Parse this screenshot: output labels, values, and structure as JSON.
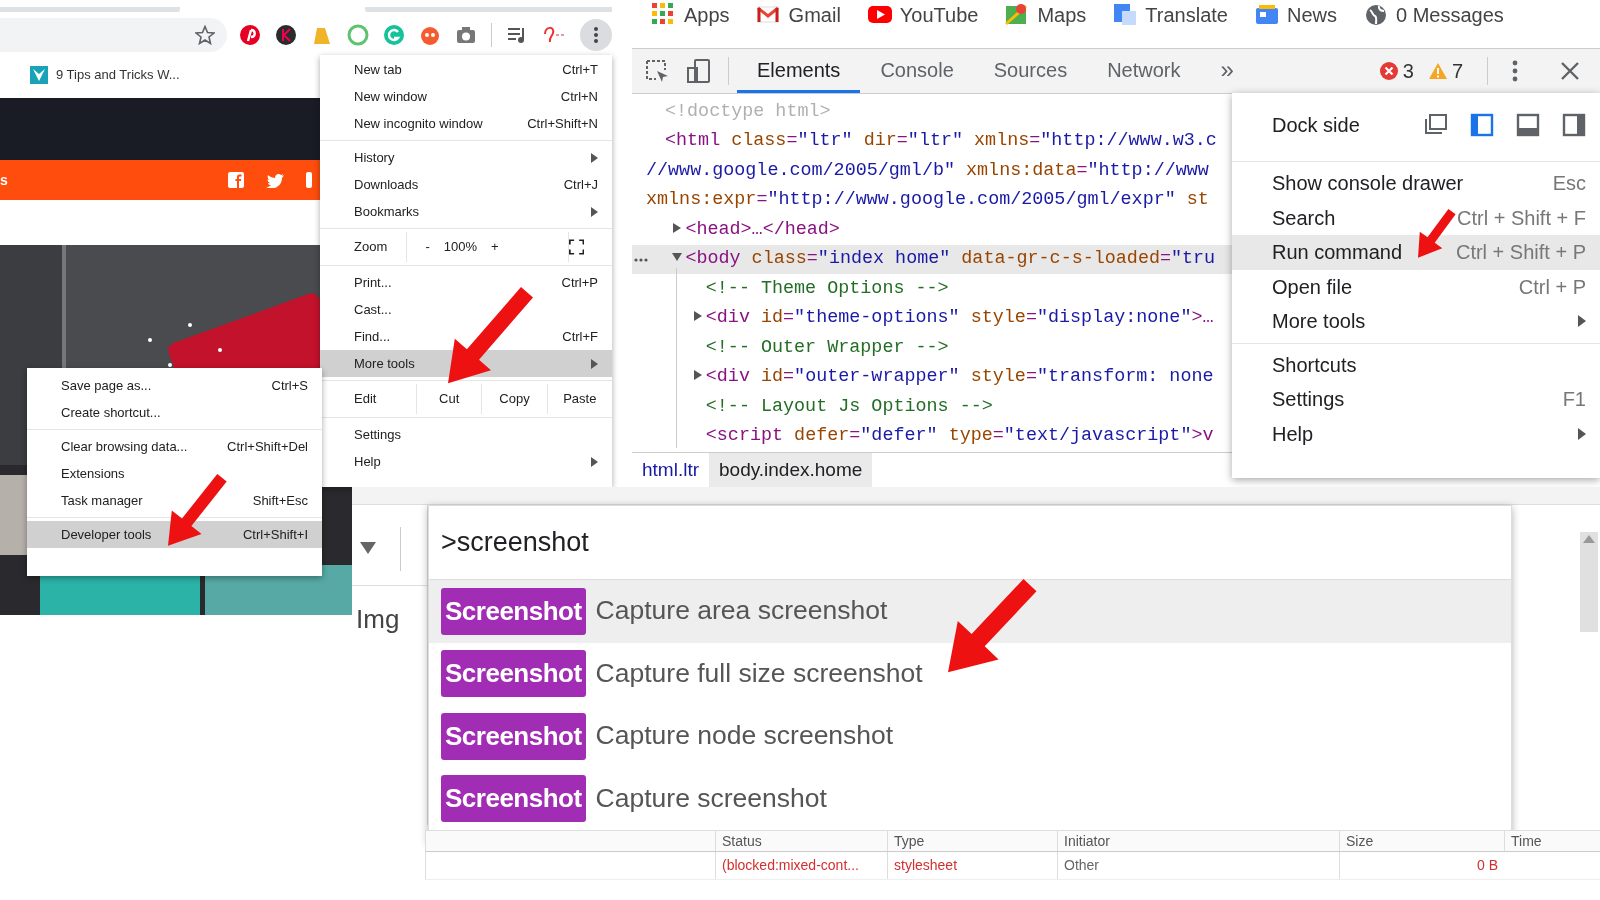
{
  "browser": {
    "bookmark": "9 Tips and Tricks W...",
    "banner_text": "s"
  },
  "chrome_menu": {
    "groups": [
      [
        {
          "kind": "item",
          "label": "New tab",
          "shortcut": "Ctrl+T",
          "submenu": false,
          "selected": false
        },
        {
          "kind": "item",
          "label": "New window",
          "shortcut": "Ctrl+N",
          "submenu": false,
          "selected": false
        },
        {
          "kind": "item",
          "label": "New incognito window",
          "shortcut": "Ctrl+Shift+N",
          "submenu": false,
          "selected": false
        }
      ],
      [
        {
          "kind": "item",
          "label": "History",
          "submenu": true,
          "selected": false
        },
        {
          "kind": "item",
          "label": "Downloads",
          "shortcut": "Ctrl+J",
          "submenu": false,
          "selected": false
        },
        {
          "kind": "item",
          "label": "Bookmarks",
          "submenu": true,
          "selected": false
        }
      ],
      [
        {
          "kind": "zoom",
          "label": "Zoom",
          "minus": "-",
          "value": "100%",
          "plus": "+",
          "submenu": false,
          "selected": false
        }
      ],
      [
        {
          "kind": "item",
          "label": "Print...",
          "shortcut": "Ctrl+P",
          "submenu": false,
          "selected": false
        },
        {
          "kind": "item",
          "label": "Cast...",
          "submenu": false,
          "selected": false
        },
        {
          "kind": "item",
          "label": "Find...",
          "shortcut": "Ctrl+F",
          "submenu": false,
          "selected": false
        },
        {
          "kind": "item",
          "label": "More tools",
          "submenu": true,
          "selected": true
        }
      ],
      [
        {
          "kind": "edit",
          "label": "Edit",
          "actions": [
            "Cut",
            "Copy",
            "Paste"
          ],
          "submenu": false,
          "selected": false
        }
      ],
      [
        {
          "kind": "item",
          "label": "Settings",
          "submenu": false,
          "selected": false
        },
        {
          "kind": "item",
          "label": "Help",
          "submenu": true,
          "selected": false
        }
      ]
    ]
  },
  "more_tools_menu": {
    "groups": [
      [
        {
          "label": "Save page as...",
          "shortcut": "Ctrl+S",
          "selected": false
        },
        {
          "label": "Create shortcut...",
          "selected": false
        }
      ],
      [
        {
          "label": "Clear browsing data...",
          "shortcut": "Ctrl+Shift+Del",
          "selected": false
        },
        {
          "label": "Extensions",
          "selected": false
        },
        {
          "label": "Task manager",
          "shortcut": "Shift+Esc",
          "selected": false
        }
      ],
      [
        {
          "label": "Developer tools",
          "shortcut": "Ctrl+Shift+I",
          "selected": true
        }
      ]
    ]
  },
  "bookmarks_bar": [
    {
      "kind": "apps",
      "label": "Apps"
    },
    {
      "kind": "mail",
      "label": "Gmail"
    },
    {
      "kind": "video",
      "label": "YouTube"
    },
    {
      "kind": "map",
      "label": "Maps"
    },
    {
      "kind": "translate",
      "label": "Translate"
    },
    {
      "kind": "news",
      "label": "News"
    },
    {
      "kind": "globe",
      "label": "0 Messages"
    }
  ],
  "devtools": {
    "tabs": [
      {
        "label": "Elements",
        "selected": true
      },
      {
        "label": "Console",
        "selected": false
      },
      {
        "label": "Sources",
        "selected": false
      },
      {
        "label": "Network",
        "selected": false
      }
    ],
    "overflow": "»",
    "errors": "3",
    "warnings": "7",
    "dom_tree": [
      {
        "selected": false,
        "lines": [
          [
            {
              "kind": "doctype",
              "text": "<!doctype html>"
            }
          ]
        ]
      },
      {
        "selected": false,
        "lines": [
          [
            {
              "kind": "tag",
              "text": "<html"
            },
            {
              "kind": "attr",
              "text": " class"
            },
            {
              "kind": "punct",
              "text": "="
            },
            {
              "kind": "value",
              "text": "\"ltr\""
            },
            {
              "kind": "attr",
              "text": " dir"
            },
            {
              "kind": "punct",
              "text": "="
            },
            {
              "kind": "value",
              "text": "\"ltr\""
            },
            {
              "kind": "attr",
              "text": " xmlns"
            },
            {
              "kind": "punct",
              "text": "="
            },
            {
              "kind": "value",
              "text": "\"http://www.w3.c"
            }
          ],
          [
            {
              "kind": "value",
              "text": "//www.google.com/2005/gml/b\""
            },
            {
              "kind": "attr",
              "text": " xmlns:data"
            },
            {
              "kind": "punct",
              "text": "="
            },
            {
              "kind": "value",
              "text": "\"http://www"
            }
          ],
          [
            {
              "kind": "attr",
              "text": "xmlns:expr"
            },
            {
              "kind": "punct",
              "text": "="
            },
            {
              "kind": "value",
              "text": "\"http://www.google.com/2005/gml/expr\""
            },
            {
              "kind": "attr",
              "text": " st"
            }
          ]
        ],
        "children": [
          {
            "expanded": false,
            "selected": false,
            "lines": [
              [
                {
                  "kind": "tag",
                  "text": "<head>…</head>"
                }
              ]
            ]
          },
          {
            "expanded": true,
            "selected": true,
            "lines": [
              [
                {
                  "kind": "tag",
                  "text": "<body"
                },
                {
                  "kind": "attr",
                  "text": " class"
                },
                {
                  "kind": "punct",
                  "text": "="
                },
                {
                  "kind": "value",
                  "text": "\"index home\""
                },
                {
                  "kind": "attr",
                  "text": " data-gr-c-s-loaded"
                },
                {
                  "kind": "punct",
                  "text": "="
                },
                {
                  "kind": "value",
                  "text": "\"tru"
                }
              ]
            ],
            "children": [
              {
                "selected": false,
                "lines": [
                  [
                    {
                      "kind": "comment",
                      "text": "<!-- Theme Options -->"
                    }
                  ]
                ]
              },
              {
                "expanded": false,
                "selected": false,
                "lines": [
                  [
                    {
                      "kind": "tag",
                      "text": "<div"
                    },
                    {
                      "kind": "attr",
                      "text": " id"
                    },
                    {
                      "kind": "punct",
                      "text": "="
                    },
                    {
                      "kind": "value",
                      "text": "\"theme-options\""
                    },
                    {
                      "kind": "attr",
                      "text": " style"
                    },
                    {
                      "kind": "punct",
                      "text": "="
                    },
                    {
                      "kind": "value",
                      "text": "\"display:none\""
                    },
                    {
                      "kind": "tag",
                      "text": ">…"
                    }
                  ]
                ]
              },
              {
                "selected": false,
                "lines": [
                  [
                    {
                      "kind": "comment",
                      "text": "<!-- Outer Wrapper -->"
                    }
                  ]
                ]
              },
              {
                "expanded": false,
                "selected": false,
                "lines": [
                  [
                    {
                      "kind": "tag",
                      "text": "<div"
                    },
                    {
                      "kind": "attr",
                      "text": " id"
                    },
                    {
                      "kind": "punct",
                      "text": "="
                    },
                    {
                      "kind": "value",
                      "text": "\"outer-wrapper\""
                    },
                    {
                      "kind": "attr",
                      "text": " style"
                    },
                    {
                      "kind": "punct",
                      "text": "="
                    },
                    {
                      "kind": "value",
                      "text": "\"transform: none"
                    }
                  ]
                ]
              },
              {
                "selected": false,
                "lines": [
                  [
                    {
                      "kind": "comment",
                      "text": "<!-- Layout Js Options -->"
                    }
                  ]
                ]
              },
              {
                "selected": false,
                "lines": [
                  [
                    {
                      "kind": "tag",
                      "text": "<script"
                    },
                    {
                      "kind": "attr",
                      "text": " defer"
                    },
                    {
                      "kind": "punct",
                      "text": "="
                    },
                    {
                      "kind": "value",
                      "text": "\"defer\""
                    },
                    {
                      "kind": "attr",
                      "text": " type"
                    },
                    {
                      "kind": "punct",
                      "text": "="
                    },
                    {
                      "kind": "value",
                      "text": "\"text/javascript\""
                    },
                    {
                      "kind": "tag",
                      "text": ">v"
                    }
                  ]
                ]
              }
            ]
          }
        ]
      }
    ],
    "breadcrumbs": [
      {
        "label": "html.ltr",
        "selected": false
      },
      {
        "label": "body.index.home",
        "selected": true
      }
    ]
  },
  "devtools_menu": {
    "dock_side": {
      "label": "Dock side",
      "options": [
        {
          "kind": "undock",
          "selected": false
        },
        {
          "kind": "left",
          "selected": true
        },
        {
          "kind": "bottom",
          "selected": false
        },
        {
          "kind": "right",
          "selected": false
        }
      ]
    },
    "groups": [
      [
        {
          "label": "Show console drawer",
          "shortcut": "Esc",
          "submenu": false,
          "selected": false
        },
        {
          "label": "Search",
          "shortcut": "Ctrl + Shift + F",
          "submenu": false,
          "selected": false
        },
        {
          "label": "Run command",
          "shortcut": "Ctrl + Shift + P",
          "submenu": false,
          "selected": true
        },
        {
          "label": "Open file",
          "shortcut": "Ctrl + P",
          "submenu": false,
          "selected": false
        },
        {
          "label": "More tools",
          "submenu": true,
          "selected": false
        }
      ],
      [
        {
          "label": "Shortcuts",
          "submenu": false,
          "selected": false
        },
        {
          "label": "Settings",
          "shortcut": "F1",
          "submenu": false,
          "selected": false
        },
        {
          "label": "Help",
          "submenu": true,
          "selected": false
        }
      ]
    ]
  },
  "network_panel": {
    "side_label": "Img",
    "command_palette": {
      "query": ">screenshot",
      "results": [
        {
          "badge": "Screenshot",
          "label": "Capture area screenshot",
          "selected": true
        },
        {
          "badge": "Screenshot",
          "label": "Capture full size screenshot",
          "selected": false
        },
        {
          "badge": "Screenshot",
          "label": "Capture node screenshot",
          "selected": false
        },
        {
          "badge": "Screenshot",
          "label": "Capture screenshot",
          "selected": false
        }
      ]
    },
    "table": {
      "columns": [
        "Status",
        "Type",
        "Initiator",
        "Size",
        "Time"
      ],
      "rows": [
        {
          "cells": [
            "(blocked:mixed-cont...",
            "stylesheet",
            "Other",
            "0 B"
          ]
        }
      ]
    }
  }
}
